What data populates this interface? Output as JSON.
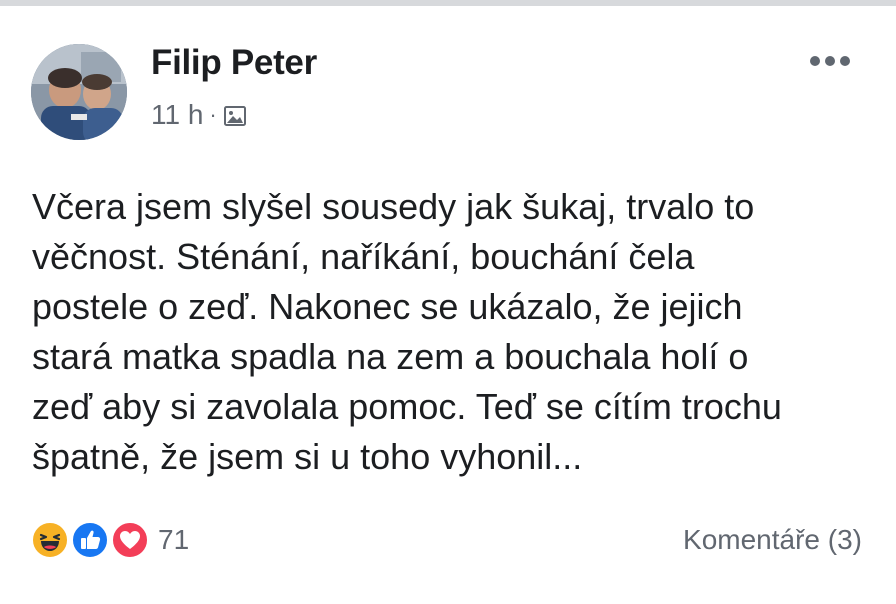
{
  "post": {
    "author": "Filip Peter",
    "time": "11 h",
    "separator": "·",
    "privacy_icon": "photo-icon",
    "more_icon": "ellipsis-icon",
    "text_lines": [
      "Včera jsem slyšel sousedy jak šukaj, trvalo to",
      "věčnost. Sténání, naříkání, bouchání čela",
      "postele o zeď. Nakonec se ukázalo, že jejich",
      "stará matka spadla na zem a bouchala holí o",
      "zeď aby si zavolala pomoc. Teď se cítím trochu",
      "špatně, že jsem si u toho vyhonil..."
    ],
    "reactions": {
      "icons": [
        "haha-icon",
        "like-icon",
        "love-icon"
      ],
      "count": "71"
    },
    "comments_label": "Komentáře (3)"
  },
  "colors": {
    "text": "#1c1e21",
    "secondary_text": "#616770",
    "like_blue": "#1877f2",
    "love_red": "#f33e58",
    "haha_yellow": "#f7b125"
  }
}
